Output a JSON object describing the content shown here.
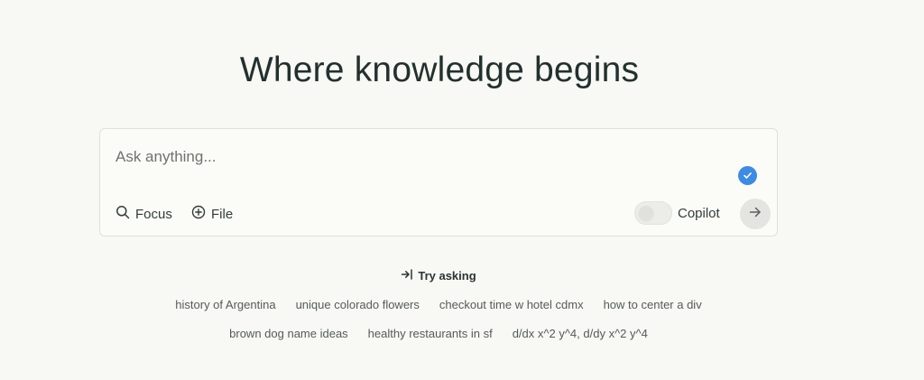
{
  "headline": "Where knowledge begins",
  "search": {
    "placeholder": "Ask anything...",
    "focus_label": "Focus",
    "file_label": "File",
    "copilot_label": "Copilot",
    "accent_color": "#3f8bdf"
  },
  "try_asking": {
    "label": "Try asking",
    "suggestions_row1": [
      "history of Argentina",
      "unique colorado flowers",
      "checkout time w hotel cdmx",
      "how to center a div"
    ],
    "suggestions_row2": [
      "brown dog name ideas",
      "healthy restaurants in sf",
      "d/dx x^2 y^4, d/dy x^2 y^4"
    ]
  },
  "icons": {
    "focus": "search-icon",
    "file": "plus-circle-icon",
    "submit": "arrow-right-icon",
    "try": "arrow-into-icon",
    "status": "check-icon"
  }
}
